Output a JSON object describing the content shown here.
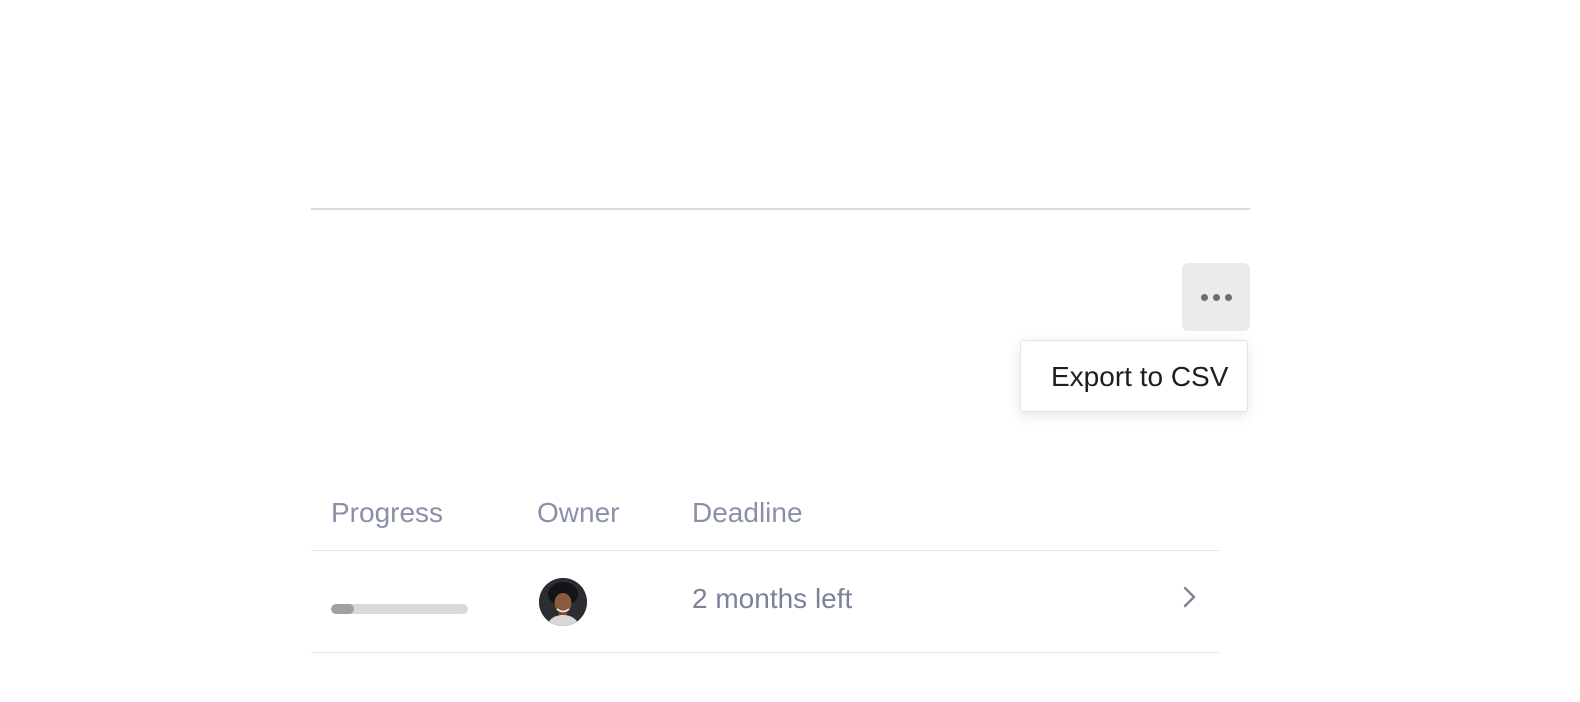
{
  "actions": {
    "more_icon": "more-horizontal-icon"
  },
  "menu": {
    "items": [
      {
        "label": "Export to CSV"
      }
    ]
  },
  "table": {
    "columns": [
      "Progress",
      "Owner",
      "Deadline"
    ],
    "rows": [
      {
        "progress": 0.17,
        "owner_avatar": "avatar",
        "deadline": "2 months left",
        "action_icon": "chevron-right-icon"
      }
    ]
  },
  "colors": {
    "header_text": "#8a90a8",
    "body_text": "#7c8298",
    "button_bg": "#ebebec",
    "progress_track": "#d9d9db",
    "progress_fill": "#9fa0a4"
  }
}
